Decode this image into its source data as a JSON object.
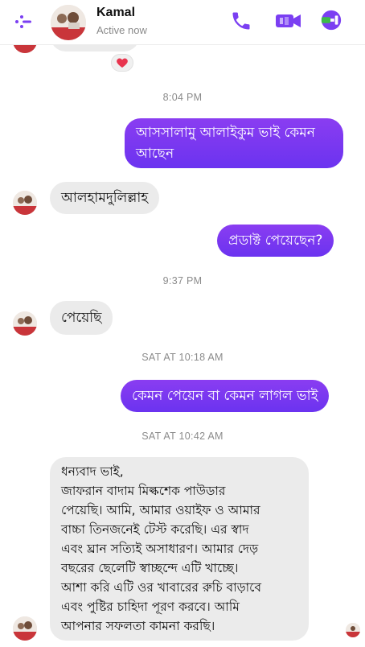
{
  "header": {
    "contact_name": "Kamal",
    "status": "Active now"
  },
  "messages": [
    {
      "type": "out",
      "text_lines": [
        "আসসালামু আলাইকুম ভাই কেমন",
        "আছেন"
      ]
    },
    {
      "type": "in",
      "text": "আলহামদুলিল্লাহ"
    },
    {
      "type": "out",
      "text": "প্রডাক্ট পেয়েছেন?"
    },
    {
      "type": "in",
      "text": "পেয়েছি"
    },
    {
      "type": "out",
      "text": "কেমন পেয়েন বা কেমন লাগল ভাই"
    },
    {
      "type": "in",
      "text_lines": [
        "ধন্যবাদ ভাই,",
        "জাফরান বাদাম মিল্কশেক পাউডার",
        "পেয়েছি। আমি, আমার ওয়াইফ ও আমার",
        "বাচ্চা তিনজনেই টেস্ট করেছি। এর স্বাদ",
        "এবং ঘ্রান সত্যিই অসাধারণ। আমার দেড়",
        "বছরের ছেলেটি স্বাচ্ছন্দে এটি খাচ্ছে।",
        "আশা করি এটি ওর খাবারের রুচি বাড়াবে",
        "এবং পুষ্টির চাহিদা পূরণ করবে। আমি",
        "আপনার সফলতা কামনা করছি।"
      ]
    }
  ],
  "timestamps": [
    "8:04 PM",
    "9:37 PM",
    "SAT AT 10:18 AM",
    "SAT AT 10:42 AM"
  ],
  "colors": {
    "accent": "#7b3ff2",
    "incoming_bubble": "#ebebeb",
    "reaction_heart": "#e8344e"
  },
  "icons": {
    "back": "back-arrow-icon",
    "call": "phone-icon",
    "video": "video-camera-icon",
    "info": "info-icon",
    "reaction": "heart-icon"
  }
}
